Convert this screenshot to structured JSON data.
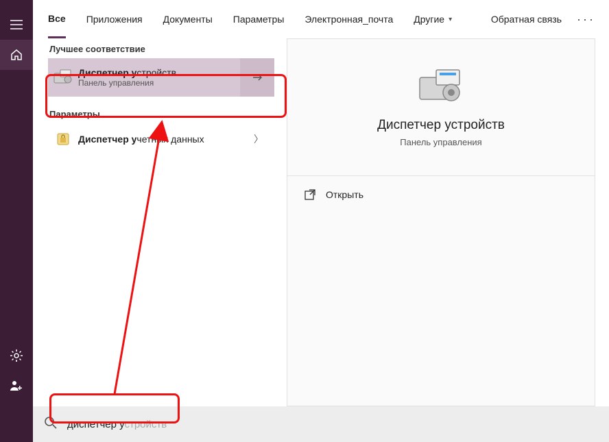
{
  "sidebar": {
    "items": [
      {
        "name": "menu-icon"
      },
      {
        "name": "home-icon",
        "active": true
      }
    ],
    "bottom": [
      {
        "name": "settings-icon"
      },
      {
        "name": "account-icon"
      }
    ]
  },
  "tabs": {
    "items": [
      {
        "label": "Все",
        "active": true
      },
      {
        "label": "Приложения"
      },
      {
        "label": "Документы"
      },
      {
        "label": "Параметры"
      },
      {
        "label": "Электронная_почта"
      },
      {
        "label": "Другие",
        "dropdown": true
      }
    ],
    "feedback": "Обратная связь"
  },
  "left": {
    "best_match_header": "Лучшее соответствие",
    "result": {
      "title_bold": "Диспетчер у",
      "title_rest": "стройств",
      "subtitle": "Панель управления"
    },
    "settings_header": "Параметры",
    "param": {
      "title_bold": "Диспетчер у",
      "title_rest": "четных данных"
    }
  },
  "detail": {
    "title": "Диспетчер устройств",
    "subtitle": "Панель управления",
    "open_label": "Открыть"
  },
  "search": {
    "typed": "диспетчер у",
    "suggestion": "стройств"
  }
}
